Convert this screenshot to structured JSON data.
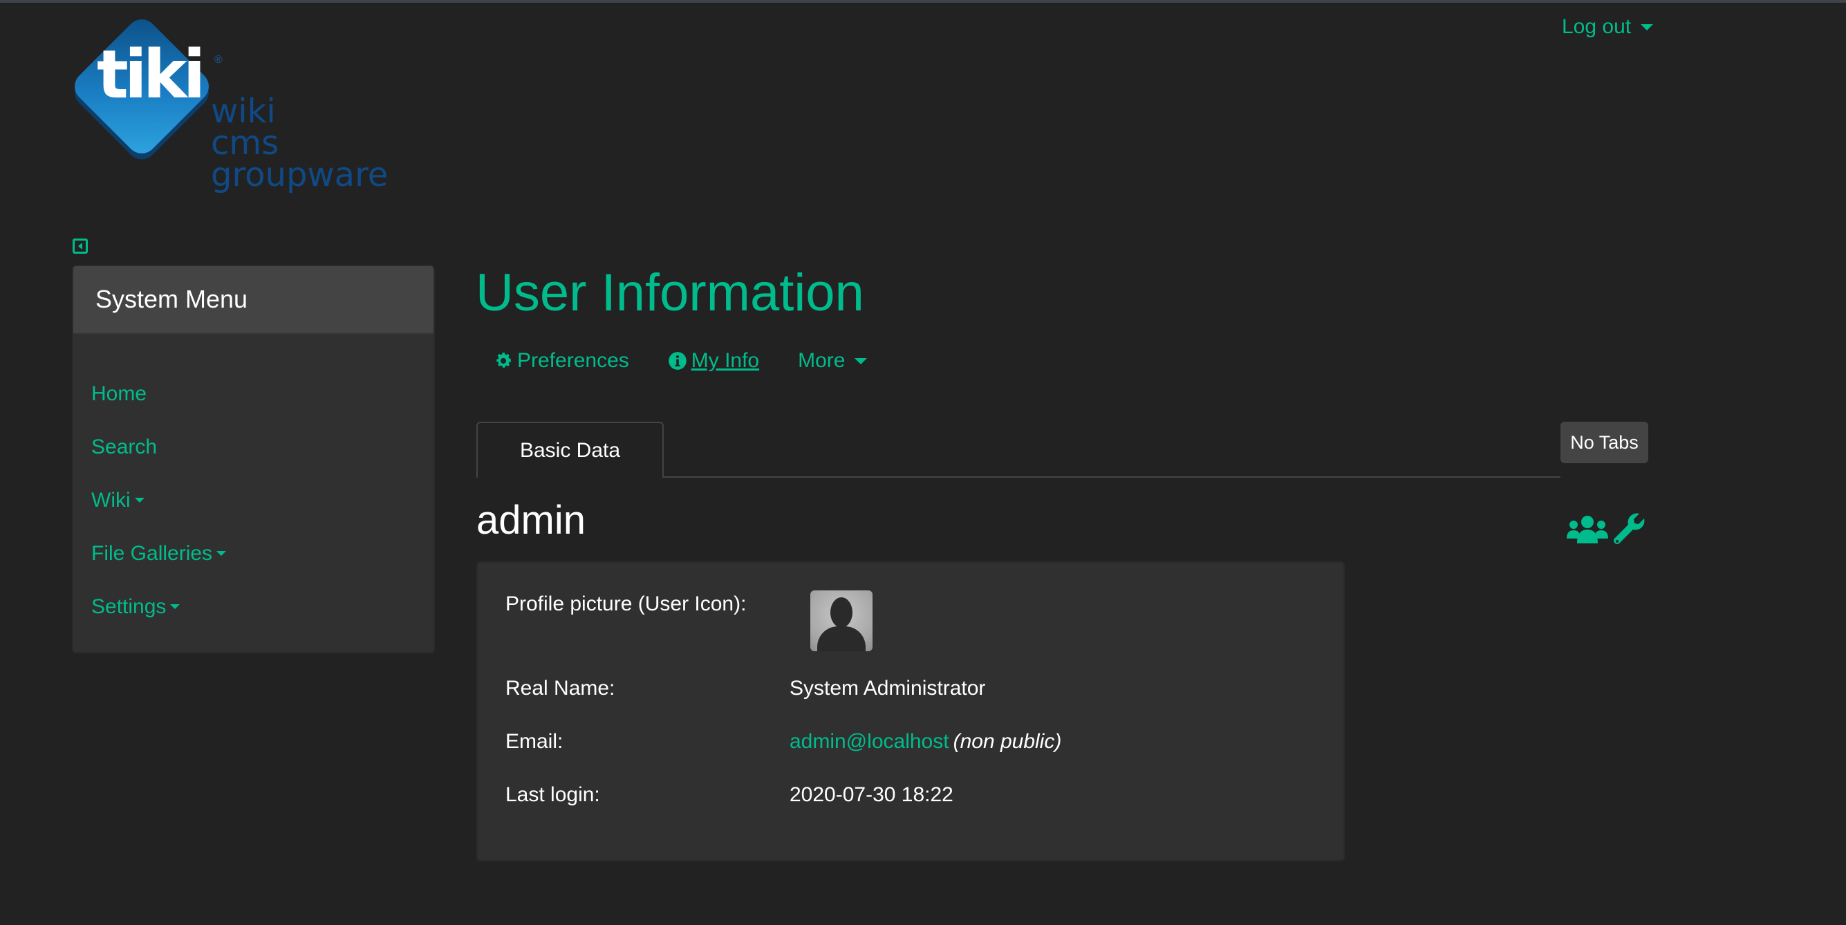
{
  "header": {
    "logo": {
      "brand": "tiki",
      "registered": "®",
      "tagline_lines": [
        "wiki",
        "cms",
        "groupware"
      ]
    },
    "logout_label": "Log out"
  },
  "sidebar": {
    "toggle_icon": "collapse-left-icon",
    "title": "System Menu",
    "items": [
      {
        "label": "Home",
        "has_dropdown": false
      },
      {
        "label": "Search",
        "has_dropdown": false
      },
      {
        "label": "Wiki",
        "has_dropdown": true
      },
      {
        "label": "File Galleries",
        "has_dropdown": true
      },
      {
        "label": "Settings",
        "has_dropdown": true
      }
    ]
  },
  "main": {
    "title": "User Information",
    "nav": [
      {
        "label": "Preferences",
        "icon": "gear-icon"
      },
      {
        "label": " My Info",
        "icon": "info-circle-icon",
        "active": true
      },
      {
        "label": "More",
        "icon": "caret-down-icon"
      }
    ],
    "tabs": [
      {
        "label": "Basic Data",
        "active": true
      }
    ],
    "no_tabs_label": "No Tabs",
    "username": "admin",
    "action_icons": [
      "users-icon",
      "wrench-icon"
    ],
    "fields": {
      "profile_picture_label": "Profile picture (User Icon):",
      "real_name_label": "Real Name:",
      "real_name_value": "System Administrator",
      "email_label": "Email:",
      "email_value": "admin@localhost",
      "email_note": "(non public)",
      "last_login_label": "Last login:",
      "last_login_value": "2020-07-30 18:22"
    }
  },
  "colors": {
    "accent": "#00bc8c",
    "background": "#222222",
    "panel": "#303030",
    "panel_header": "#444444"
  }
}
